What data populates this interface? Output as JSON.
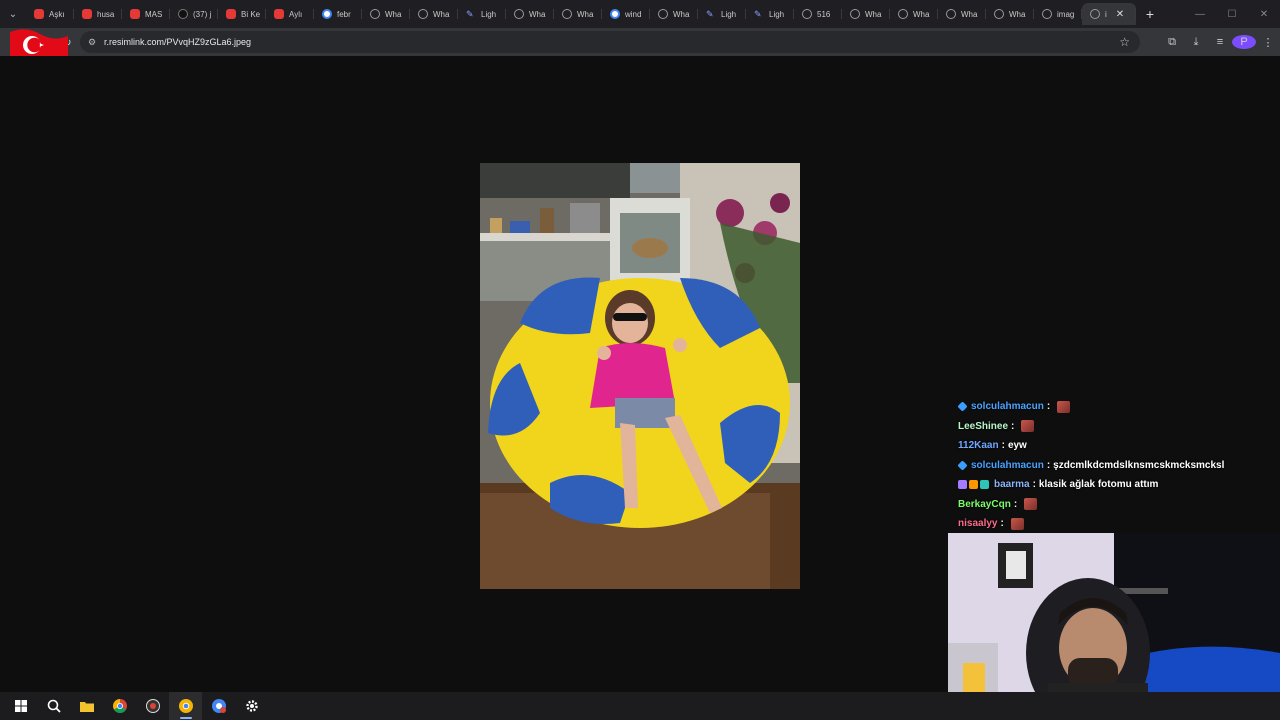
{
  "browser": {
    "tabs": [
      {
        "label": "Aşkı",
        "favicon": "youtube-icon"
      },
      {
        "label": "husa",
        "favicon": "youtube-icon"
      },
      {
        "label": "MAS",
        "favicon": "youtube-icon"
      },
      {
        "label": "(37) j",
        "favicon": "tiktok-icon"
      },
      {
        "label": "Bi Ke",
        "favicon": "youtube-icon"
      },
      {
        "label": "Aylı",
        "favicon": "youtube-icon"
      },
      {
        "label": "febr",
        "favicon": "google-icon"
      },
      {
        "label": "Wha",
        "favicon": "globe-icon"
      },
      {
        "label": "Wha",
        "favicon": "globe-icon"
      },
      {
        "label": "Ligh",
        "favicon": "pen-icon"
      },
      {
        "label": "Wha",
        "favicon": "globe-icon"
      },
      {
        "label": "Wha",
        "favicon": "globe-icon"
      },
      {
        "label": "wind",
        "favicon": "google-icon"
      },
      {
        "label": "Wha",
        "favicon": "globe-icon"
      },
      {
        "label": "Ligh",
        "favicon": "pen-icon"
      },
      {
        "label": "Ligh",
        "favicon": "pen-icon"
      },
      {
        "label": "516",
        "favicon": "globe-icon"
      },
      {
        "label": "Wha",
        "favicon": "globe-icon"
      },
      {
        "label": "Wha",
        "favicon": "globe-icon"
      },
      {
        "label": "Wha",
        "favicon": "globe-icon"
      },
      {
        "label": "Wha",
        "favicon": "globe-icon"
      },
      {
        "label": "imag",
        "favicon": "globe-icon"
      },
      {
        "label": "i",
        "favicon": "globe-icon",
        "active": true
      }
    ],
    "new_tab_label": "+",
    "url": "r.resimlink.com/PVvqHZ9zGLa6.jpeg"
  },
  "chat": {
    "messages": [
      {
        "user": "solculahmacun",
        "color": "#4aa3ff",
        "badge": "blue",
        "text": "",
        "emote": true
      },
      {
        "user": "LeeShinee",
        "color": "#b9f6ca",
        "badge": "",
        "text": "",
        "emote": true
      },
      {
        "user": "112Kaan",
        "color": "#6fa8ff",
        "badge": "",
        "text": "eyw",
        "emote": false
      },
      {
        "user": "solculahmacun",
        "color": "#4aa3ff",
        "badge": "blue",
        "text": "şzdcmlkdcmdslknsmcskmcksmcksl",
        "emote": false
      },
      {
        "user": "baarma",
        "color": "#8ab4f8",
        "badge": "multi",
        "text": "klasik ağlak fotomu attım",
        "emote": false
      },
      {
        "user": "BerkayCqn",
        "color": "#7cfc6a",
        "badge": "",
        "text": "",
        "emote": true
      },
      {
        "user": "nisaalyy",
        "color": "#ff6b8b",
        "badge": "",
        "text": "",
        "emote": true
      }
    ]
  },
  "taskbar": {
    "items": [
      "windows-start-icon",
      "search-icon",
      "file-explorer-icon",
      "chrome-icon",
      "chrome-alt-icon",
      "chrome-active-icon",
      "chrome-profile-icon",
      "settings-icon"
    ]
  }
}
